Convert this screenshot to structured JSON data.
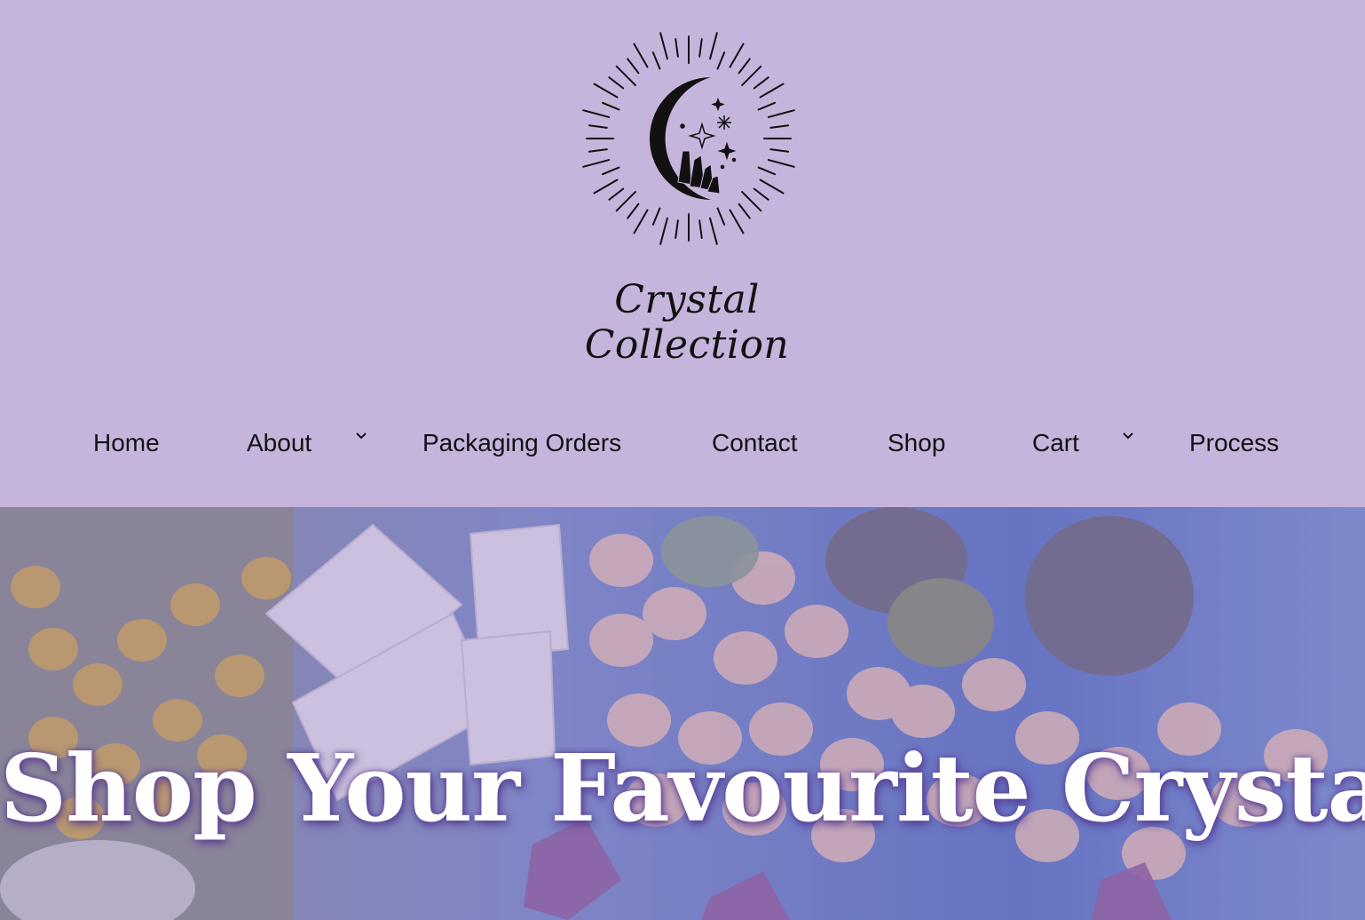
{
  "brand": {
    "name": "Crystal Collection",
    "logo_icon": "crescent-moon-crystal-logo"
  },
  "nav": {
    "items": [
      {
        "label": "Home",
        "has_submenu": false
      },
      {
        "label": "About",
        "has_submenu": true,
        "icon": "chevron-down-icon"
      },
      {
        "label": "Packaging Orders",
        "has_submenu": false
      },
      {
        "label": "Contact",
        "has_submenu": false
      },
      {
        "label": "Shop",
        "has_submenu": false
      },
      {
        "label": "Cart",
        "has_submenu": true,
        "icon": "chevron-down-icon"
      },
      {
        "label": "Process",
        "has_submenu": false
      }
    ]
  },
  "hero": {
    "title": "Shop Your Favourite Crystals!",
    "image": "crystals-on-mirror-background"
  },
  "colors": {
    "header_bg": "#c5b4dc",
    "text": "#111111",
    "hero_title": "#ffffff"
  }
}
